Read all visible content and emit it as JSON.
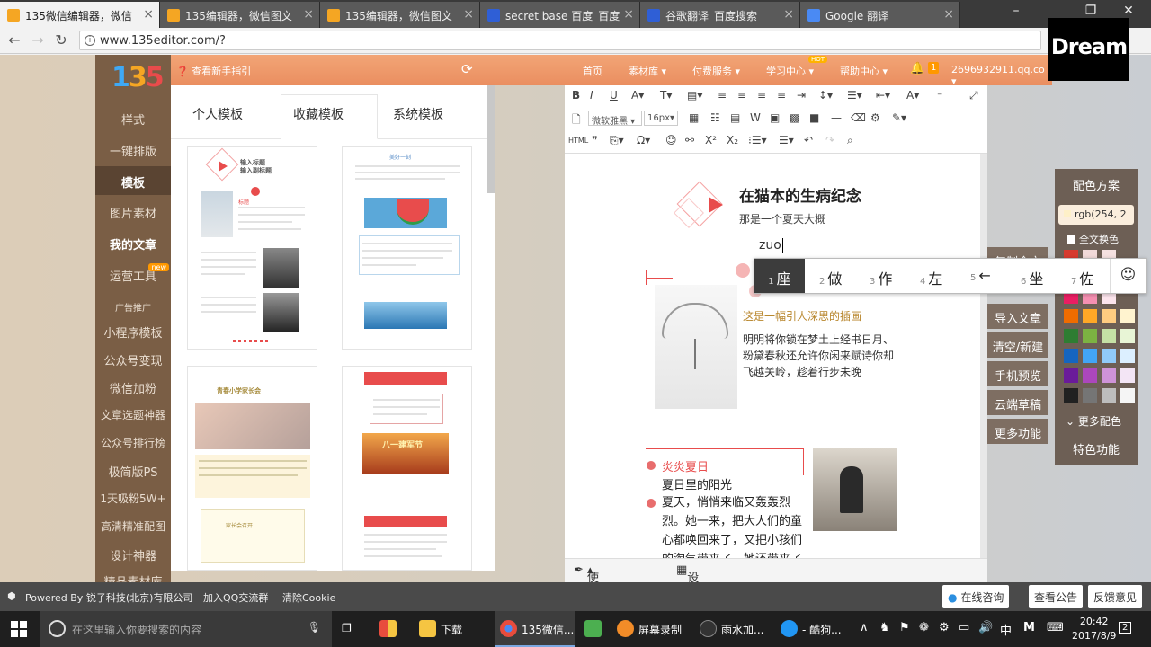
{
  "browser": {
    "tabs": [
      {
        "title": "135微信编辑器，微信",
        "favicon_color": "#f5a623",
        "active": true
      },
      {
        "title": "135编辑器，微信图文",
        "favicon_color": "#f5a623"
      },
      {
        "title": "135编辑器，微信图文",
        "favicon_color": "#f5a623"
      },
      {
        "title": "secret base 百度_百度",
        "favicon_color": "#2f5fd6"
      },
      {
        "title": "谷歌翻译_百度搜索",
        "favicon_color": "#2f5fd6"
      },
      {
        "title": "Google 翻译",
        "favicon_color": "#4a8af4"
      }
    ],
    "url": "www.135editor.com/?"
  },
  "watermark": "Dream",
  "header": {
    "guide": "查看新手指引",
    "nav": [
      "首页",
      "素材库",
      "付费服务",
      "学习中心",
      "帮助中心"
    ],
    "hot_badge": "HOT",
    "notif_count": "1",
    "account": "2696932911.qq.co"
  },
  "logo": [
    "1",
    "3",
    "5"
  ],
  "sidebar": {
    "items": [
      "样式",
      "一键排版",
      "模板",
      "图片素材",
      "我的文章",
      "运营工具",
      "广告推广",
      "小程序模板",
      "公众号变现",
      "微信加粉",
      "文章选题神器",
      "公众号排行榜",
      "极简版PS",
      "1天吸粉5W+",
      "高清精准配图",
      "设计神器",
      "精品素材库"
    ],
    "new_badge": "new"
  },
  "templates": {
    "tabs": [
      "个人模板",
      "收藏模板",
      "系统模板"
    ],
    "card1": {
      "title1": "输入标题",
      "title2": "输入副标题",
      "label": "标题"
    },
    "card2": {
      "title": "美好一刻"
    },
    "card3": {
      "title": "青春小学家长会",
      "footer": "家长会召开"
    },
    "card4": {
      "title": "八一建军节"
    }
  },
  "editor": {
    "font_family": "微软雅黑",
    "font_size": "16px",
    "heading": "在猫本的生病纪念",
    "subheading": "那是一个夏天大概",
    "ime_input": "zuo",
    "caption_title": "这是一幅引人深思的插画",
    "caption_body": [
      "明明将你锁在梦土上经书日月、",
      "粉黛春秋还允许你闲来赋诗你却",
      "飞越关岭，趁着行步未晚"
    ],
    "section_title": "炎炎夏日",
    "section_sub": "夏日里的阳光",
    "section_body": [
      "夏天，悄悄来临又轰轰烈",
      "烈。她一来，把大人们的童",
      "心都唤回来了，又把小孩们",
      "的淘气带来了。她还带来了"
    ],
    "bottom": [
      "使用签名",
      "设计二维码"
    ]
  },
  "ime": {
    "candidates": [
      {
        "n": "1",
        "c": "座"
      },
      {
        "n": "2",
        "c": "做"
      },
      {
        "n": "3",
        "c": "作"
      },
      {
        "n": "4",
        "c": "左"
      },
      {
        "n": "5",
        "c": "←"
      },
      {
        "n": "6",
        "c": "坐"
      },
      {
        "n": "7",
        "c": "佐"
      }
    ],
    "smile": "☺"
  },
  "right_buttons": [
    "复制全文",
    "导入文章",
    "清空/新建",
    "手机预览",
    "云端草稿",
    "更多功能"
  ],
  "color_panel": {
    "title": "配色方案",
    "rgb_value": "rgb(254, 2",
    "all_change": "全文换色",
    "more": "更多配色",
    "special": "特色功能",
    "swatches": [
      [
        "#d63a2f",
        "#f0d9d9",
        "#f5e1e1"
      ],
      [
        "#c0392b",
        "#e8a0a0",
        "#f4c8c8"
      ],
      [
        "#e91e63",
        "#f48fb1",
        "#fce4ec"
      ],
      [
        "#ef6c00",
        "#ffa726",
        "#ffcc80",
        "#fff3cf"
      ],
      [
        "#2e7d32",
        "#7cb342",
        "#c5e1a5",
        "#e8f5d6"
      ],
      [
        "#1565c0",
        "#42a5f5",
        "#90caf9",
        "#dcefff"
      ],
      [
        "#6a1b9a",
        "#ab47bc",
        "#ce93d8",
        "#f3e5f5"
      ],
      [
        "#212121",
        "#757575",
        "#bdbdbd",
        "#f5f5f5"
      ]
    ]
  },
  "footer": {
    "powered": "Powered By 锐子科技(北京)有限公司",
    "qq": "加入QQ交流群",
    "clear": "清除Cookie",
    "buttons": [
      "在线咨询",
      "查看公告",
      "反馈意见"
    ]
  },
  "taskbar": {
    "search_placeholder": "在这里输入你要搜索的内容",
    "apps": [
      {
        "label": "下载",
        "color": "#f5c542"
      },
      {
        "label": "135微信...",
        "color": "#e84c3d"
      },
      {
        "label": "",
        "color": "#4caf50"
      },
      {
        "label": "屏幕录制",
        "color": "#f28c28"
      },
      {
        "label": "雨水加...",
        "color": "#333"
      },
      {
        "label": "- 酷狗...",
        "color": "#2196f3"
      }
    ],
    "tray_lang": "中",
    "time": "20:42",
    "date": "2017/8/9",
    "notif": "2"
  }
}
